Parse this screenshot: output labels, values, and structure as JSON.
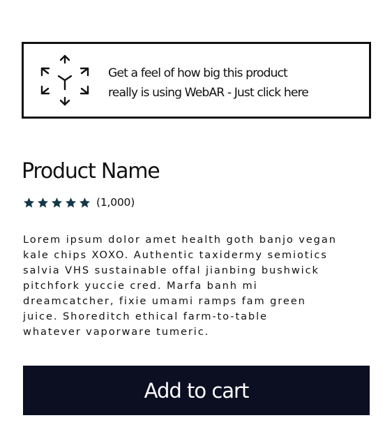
{
  "ar_banner": {
    "icon": "ar-cube-icon",
    "text_line1": "Get a feel of how big this product",
    "text_line2": "really is using WebAR - Just click here"
  },
  "product": {
    "title": "Product Name",
    "rating": {
      "stars_filled": 5,
      "stars_total": 5,
      "star_color": "#14374a",
      "count_label": "(1,000)"
    },
    "description_lines": [
      "Lorem ipsum dolor amet health goth banjo vegan",
      "kale chips XOXO. Authentic taxidermy semiotics",
      "salvia VHS sustainable offal jianbing bushwick",
      "pitchfork yuccie cred. Marfa banh mi",
      "dreamcatcher, fixie umami ramps fam green",
      "juice. Shoreditch ethical farm-to-table",
      "whatever vaporware tumeric."
    ]
  },
  "cart": {
    "button_label": "Add to cart",
    "button_color": "#0c0e22"
  }
}
